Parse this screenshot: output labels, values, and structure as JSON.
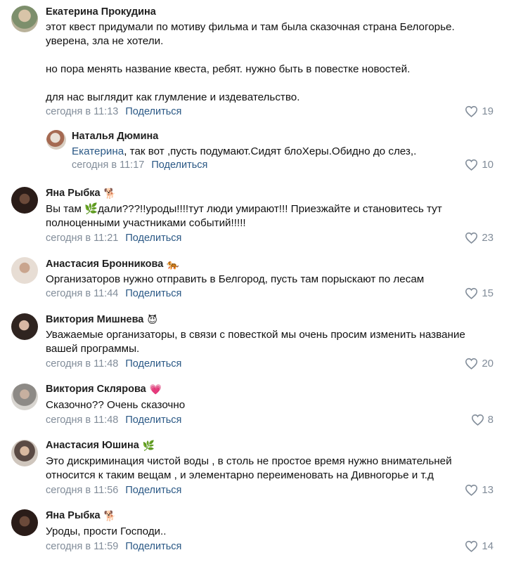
{
  "share_label": "Поделиться",
  "comments": [
    {
      "author": "Екатерина Прокудина",
      "emoji": "",
      "text": "этот квест придумали по мотиву фильма и там была сказочная страна Белогорье.\nуверена, зла не хотели.\n\nно пора менять название квеста, ребят. нужно быть в повестке новостей.\n\nдля нас выглядит как глумление и издевательство.",
      "time": "сегодня в 11:13",
      "likes": "19"
    },
    {
      "author": "Наталья Дюмина",
      "emoji": "",
      "mention": "Екатерина",
      "text": ", так вот ,пусть подумают.Сидят блоХеры.Обидно до слез,.",
      "time": "сегодня в 11:17",
      "likes": "10"
    },
    {
      "author": "Яна Рыбка",
      "emoji": "🐕",
      "text": "Вы там 🌿дали???!!уроды!!!!тут люди умирают!!! Приезжайте и становитесь тут\nполноценными участниками событий!!!!!",
      "time": "сегодня в 11:21",
      "likes": "23"
    },
    {
      "author": "Анастасия Бронникова",
      "emoji": "🐅",
      "text": "Организаторов нужно отправить в Белгород, пусть там порыскают по лесам",
      "time": "сегодня в 11:44",
      "likes": "15"
    },
    {
      "author": "Виктория Мишнева",
      "emoji": "😈",
      "text": "Уважаемые организаторы, в связи с повесткой мы очень просим изменить название\nвашей программы.",
      "time": "сегодня в 11:48",
      "likes": "20"
    },
    {
      "author": "Виктория Склярова",
      "emoji": "💗",
      "text": "Сказочно?? Очень сказочно",
      "time": "сегодня в 11:48",
      "likes": "8"
    },
    {
      "author": "Анастасия Юшина",
      "emoji": "🌿",
      "text": "Это дискриминация чистой воды , в столь не простое время нужно внимательней\nотносится к таким вещам , и элементарно переименовать на Дивногорье и т.д",
      "time": "сегодня в 11:56",
      "likes": "13"
    },
    {
      "author": "Яна Рыбка",
      "emoji": "🐕",
      "text": "Уроды, прости Господи..",
      "time": "сегодня в 11:59",
      "likes": "14"
    }
  ],
  "colors": {
    "link": "#2a5885",
    "meta": "#818c99"
  }
}
